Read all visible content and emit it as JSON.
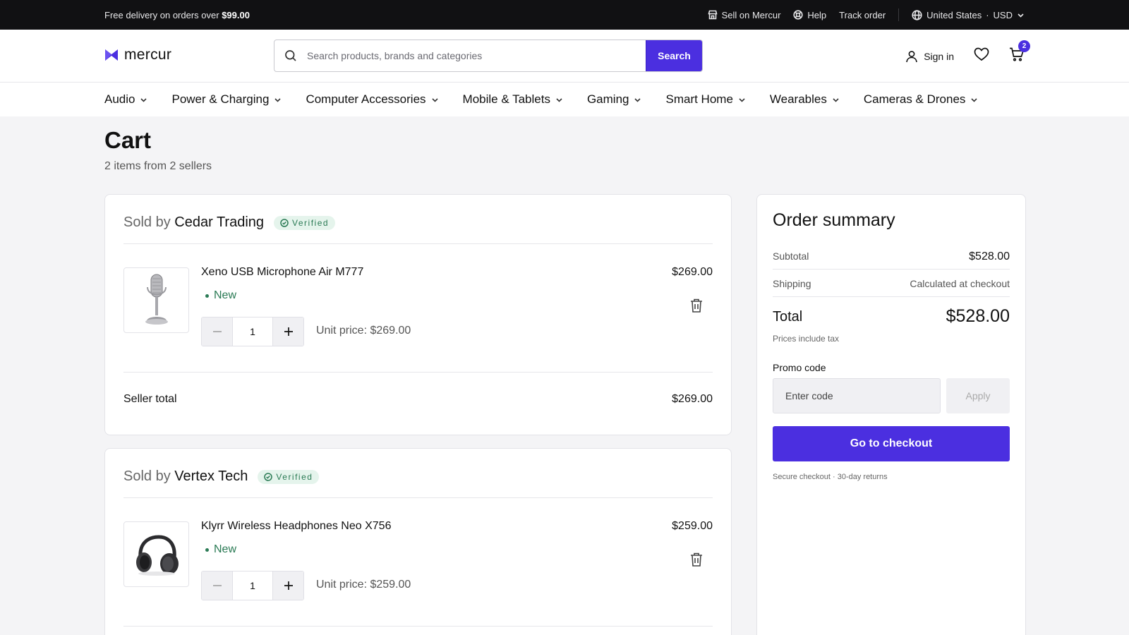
{
  "topbar": {
    "promo_text": "Free delivery on orders over ",
    "promo_amount": "$99.00",
    "sell": "Sell on Mercur",
    "help": "Help",
    "track": "Track order",
    "region": "United States",
    "currency": "USD"
  },
  "header": {
    "logo_text": "mercur",
    "search_placeholder": "Search products, brands and categories",
    "search_button": "Search",
    "sign_in": "Sign in",
    "cart_count": "2"
  },
  "categories": [
    "Audio",
    "Power & Charging",
    "Computer Accessories",
    "Mobile & Tablets",
    "Gaming",
    "Smart Home",
    "Wearables",
    "Cameras & Drones"
  ],
  "cart": {
    "title": "Cart",
    "subtitle": "2 items from 2 sellers",
    "sold_by_label": "Sold by",
    "verified_label": "Verified",
    "seller_total_label": "Seller total",
    "sellers": [
      {
        "name": "Cedar Trading",
        "total": "$269.00",
        "items": [
          {
            "name": "Xeno USB Microphone Air M777",
            "condition": "New",
            "quantity": "1",
            "unit_price": "Unit price: $269.00",
            "price": "$269.00"
          }
        ]
      },
      {
        "name": "Vertex Tech",
        "total": "",
        "items": [
          {
            "name": "Klyrr Wireless Headphones Neo X756",
            "condition": "New",
            "quantity": "1",
            "unit_price": "Unit price: $259.00",
            "price": "$259.00"
          }
        ]
      }
    ]
  },
  "summary": {
    "title": "Order summary",
    "subtotal_label": "Subtotal",
    "subtotal_value": "$528.00",
    "shipping_label": "Shipping",
    "shipping_value": "Calculated at checkout",
    "total_label": "Total",
    "total_value": "$528.00",
    "tax_note": "Prices include tax",
    "promo_label": "Promo code",
    "promo_placeholder": "Enter code",
    "apply_button": "Apply",
    "checkout_button": "Go to checkout",
    "secure_note": "Secure checkout · 30-day returns"
  },
  "colors": {
    "accent": "#4b2fe0",
    "verified_bg": "#e5f4ec",
    "verified_text": "#2a7a54",
    "topbar_bg": "#111113"
  }
}
